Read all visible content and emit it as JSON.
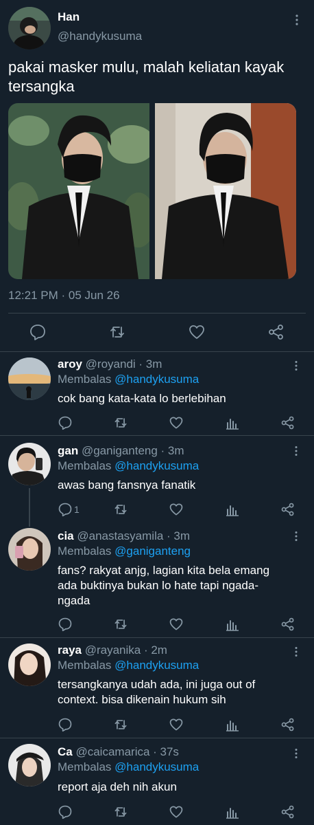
{
  "tweet": {
    "name": "Han",
    "handle": "@handykusuma",
    "text": "pakai masker mulu, malah keliatan kayak tersangka",
    "timestamp": "12:21 PM · 05 Jun 26"
  },
  "replies": [
    {
      "name": "aroy",
      "meta": "@royandi · 3m",
      "replying_label": "Membalas",
      "replying_to": "@handykusuma",
      "text": "cok bang kata-kata lo berlebihan",
      "reply_count": ""
    },
    {
      "name": "gan",
      "meta": "@ganiganteng · 3m",
      "replying_label": "Membalas",
      "replying_to": "@handykusuma",
      "text": "awas bang fansnya fanatik",
      "reply_count": "1"
    },
    {
      "name": "cia",
      "meta": "@anastasyamila · 3m",
      "replying_label": "Membalas",
      "replying_to": "@ganiganteng",
      "text": "fans? rakyat anjg, lagian kita bela emang ada buktinya bukan lo hate tapi ngada-ngada",
      "reply_count": ""
    },
    {
      "name": "raya",
      "meta": "@rayanika · 2m",
      "replying_label": "Membalas",
      "replying_to": "@handykusuma",
      "text": "tersangkanya udah ada, ini juga out of context. bisa dikenain hukum sih",
      "reply_count": ""
    },
    {
      "name": "Ca",
      "meta": "@caicamarica · 37s",
      "replying_label": "Membalas",
      "replying_to": "@handykusuma",
      "text": "report aja deh nih akun",
      "reply_count": ""
    }
  ],
  "icons": [
    "reply-icon",
    "retweet-icon",
    "like-icon",
    "share-icon",
    "analytics-icon",
    "more-icon"
  ],
  "colors": {
    "background": "#15202b",
    "border": "#38444d",
    "muted": "#8899a6",
    "accent": "#1da1f2"
  }
}
